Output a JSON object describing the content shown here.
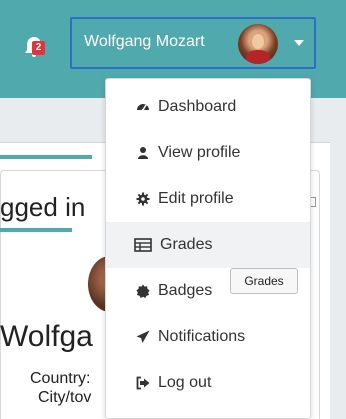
{
  "navbar": {
    "notification_count": "2",
    "user_name": "Wolfgang Mozart"
  },
  "menu": {
    "items": [
      {
        "label": "Dashboard",
        "icon": "dashboard-icon"
      },
      {
        "label": "View profile",
        "icon": "user-icon"
      },
      {
        "label": "Edit profile",
        "icon": "cog-icon"
      },
      {
        "label": "Grades",
        "icon": "table-icon"
      },
      {
        "label": "Badges",
        "icon": "badge-icon"
      },
      {
        "label": "Notifications",
        "icon": "paper-plane-icon"
      },
      {
        "label": "Log out",
        "icon": "sign-out-icon"
      }
    ]
  },
  "tooltip": {
    "text": "Grades"
  },
  "background": {
    "logged_in_fragment": "gged in",
    "name_fragment": "Wolfga",
    "country_fragment": "Country:",
    "city_fragment": "City/tov"
  },
  "colors": {
    "navbar": "#50a9ad",
    "toggle_border": "#2f6fc1",
    "badge": "#e0353b"
  }
}
